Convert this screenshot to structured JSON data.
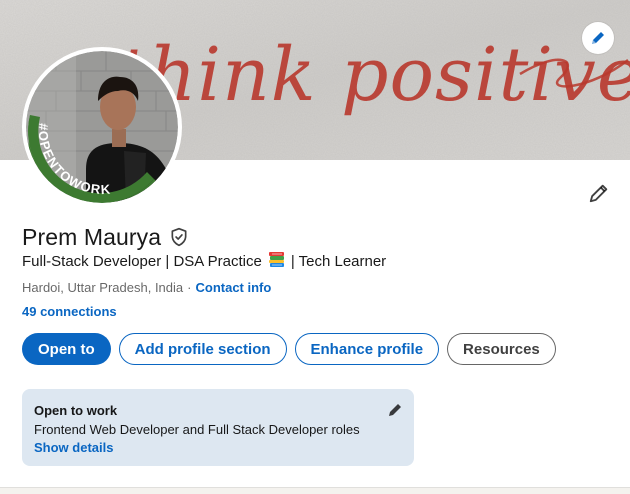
{
  "cover": {
    "text": "think positive",
    "edit_icon": "pencil-icon"
  },
  "avatar": {
    "badge_text": "#OPENTOWORK"
  },
  "intro_edit_icon": "pencil-icon",
  "profile": {
    "name": "Prem Maurya",
    "verified_icon": "verified-shield-icon",
    "headline_part1": "Full-Stack Developer | DSA Practice",
    "headline_emoji": "books-icon",
    "headline_part2": "| Tech Learner",
    "location": "Hardoi, Uttar Pradesh, India",
    "separator": "·",
    "contact_info": "Contact info",
    "connections": "49 connections"
  },
  "actions": {
    "open_to": "Open to",
    "add_profile_section": "Add profile section",
    "enhance_profile": "Enhance profile",
    "resources": "Resources"
  },
  "open_to_work": {
    "title": "Open to work",
    "description": "Frontend Web Developer and Full Stack Developer roles",
    "show_details": "Show details",
    "edit_icon": "pencil-icon"
  },
  "colors": {
    "accent": "#0a66c2",
    "otw_background": "#dde7f1",
    "otw_ring": "#3d7a31",
    "cover_text": "#b9382d"
  }
}
